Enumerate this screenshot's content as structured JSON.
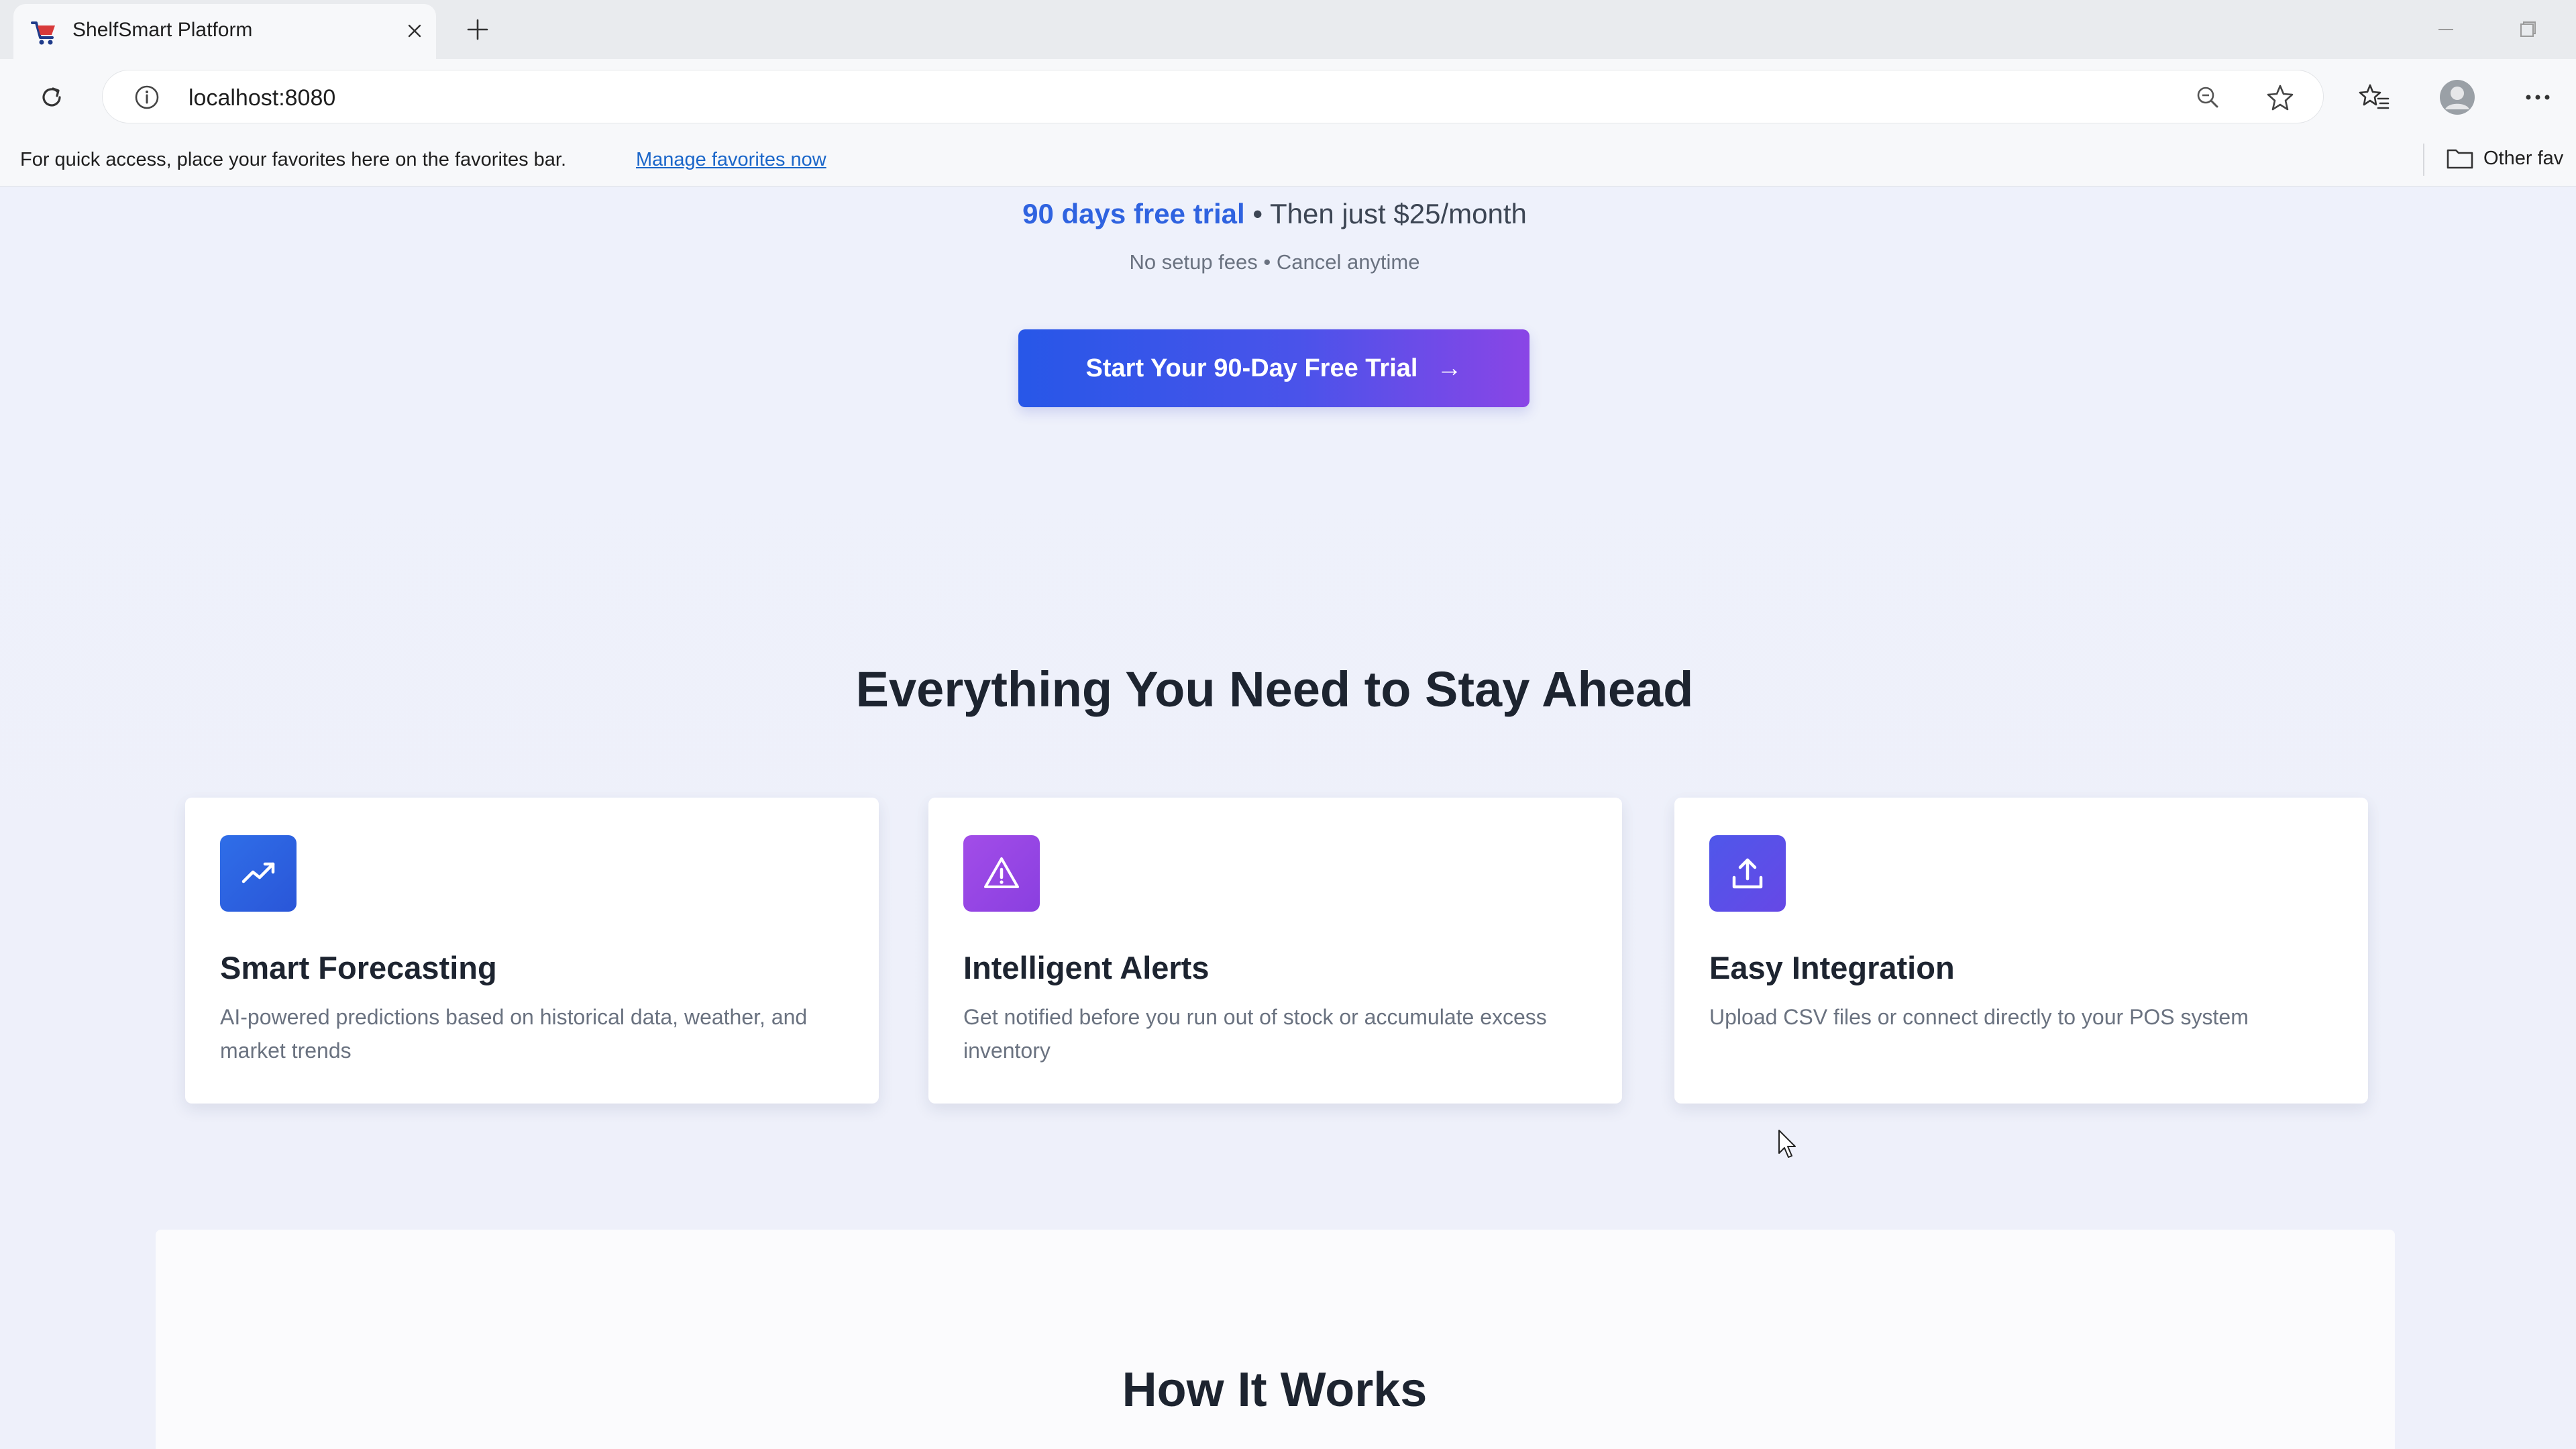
{
  "browser": {
    "tab_title": "ShelfSmart Platform",
    "url": "localhost:8080",
    "favorites_bar_text": "For quick access, place your favorites here on the favorites bar.",
    "favorites_link": "Manage favorites now",
    "other_favorites": "Other fav"
  },
  "hero": {
    "trial_strong": "90 days free trial",
    "trial_rest": " • Then just $25/month",
    "trial_sub": "No setup fees • Cancel anytime",
    "cta_label": "Start Your 90-Day Free Trial",
    "cta_arrow": "→"
  },
  "features": {
    "heading": "Everything You Need to Stay Ahead",
    "cards": [
      {
        "title": "Smart Forecasting",
        "description": "AI-powered predictions based on historical data, weather, and market trends",
        "icon": "trending-up-icon",
        "color": "#2f63e0"
      },
      {
        "title": "Intelligent Alerts",
        "description": "Get notified before you run out of stock or accumulate excess inventory",
        "icon": "warning-triangle-icon",
        "color": "#9b4be6"
      },
      {
        "title": "Easy Integration",
        "description": "Upload CSV files or connect directly to your POS system",
        "icon": "upload-icon",
        "color": "#5a4fe6"
      }
    ]
  },
  "how_it_works": {
    "heading": "How It Works"
  }
}
